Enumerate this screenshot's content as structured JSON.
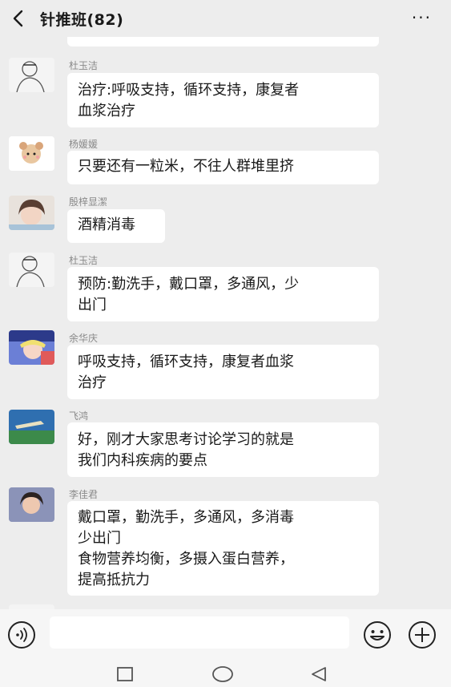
{
  "header": {
    "title": "针推班(82)",
    "more": "···"
  },
  "messages": [
    {
      "sender": "杜玉洁",
      "avatar": "sketch-avatar",
      "lines": [
        "治疗:呼吸支持，循环支持，康复者",
        "血浆治疗"
      ]
    },
    {
      "sender": "杨媛媛",
      "avatar": "bear-avatar",
      "lines": [
        "只要还有一粒米，不往人群堆里挤"
      ]
    },
    {
      "sender": "殷梓显潔",
      "avatar": "girl-photo-avatar",
      "lines": [
        "酒精消毒"
      ]
    },
    {
      "sender": "杜玉洁",
      "avatar": "sketch-avatar",
      "lines": [
        "预防:勤洗手，戴口罩，多通风，少",
        "出门"
      ]
    },
    {
      "sender": "余华庆",
      "avatar": "anime-avatar",
      "lines": [
        "呼吸支持，循环支持，康复者血浆",
        "治疗"
      ]
    },
    {
      "sender": "飞鸿",
      "avatar": "landscape-avatar",
      "lines": [
        "好，刚才大家思考讨论学习的就是",
        "我们内科疾病的要点"
      ]
    },
    {
      "sender": "李佳君",
      "avatar": "portrait-avatar",
      "lines": [
        "戴口罩，勤洗手，多通风，多消毒",
        "少出门",
        "食物营养均衡，多摄入蛋白营养，",
        "提高抵抗力"
      ]
    }
  ],
  "input": {
    "value": ""
  }
}
